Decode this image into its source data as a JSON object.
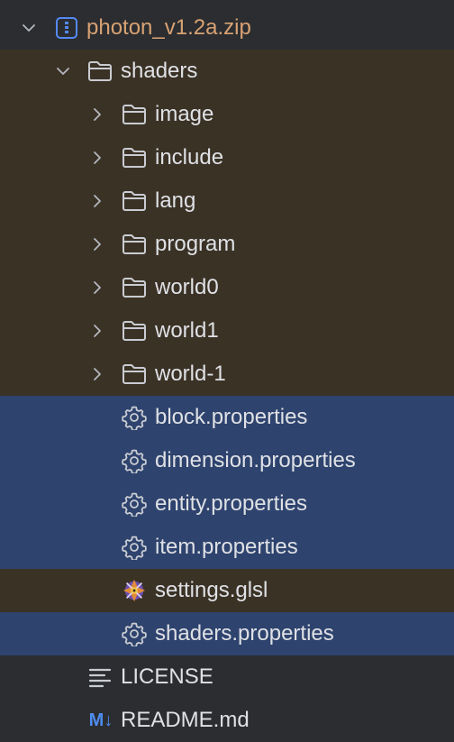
{
  "tree": {
    "root": {
      "label": "photon_v1.2a.zip",
      "icon": "archive-icon",
      "expanded": true
    },
    "shaders_folder": {
      "label": "shaders",
      "icon": "folder-icon",
      "expanded": true
    },
    "subfolders": [
      {
        "label": "image",
        "icon": "folder-icon"
      },
      {
        "label": "include",
        "icon": "folder-icon"
      },
      {
        "label": "lang",
        "icon": "folder-icon"
      },
      {
        "label": "program",
        "icon": "folder-icon"
      },
      {
        "label": "world0",
        "icon": "folder-icon"
      },
      {
        "label": "world1",
        "icon": "folder-icon"
      },
      {
        "label": "world-1",
        "icon": "folder-icon"
      }
    ],
    "files": [
      {
        "label": "block.properties",
        "icon": "gear-icon",
        "selected": true
      },
      {
        "label": "dimension.properties",
        "icon": "gear-icon",
        "selected": true
      },
      {
        "label": "entity.properties",
        "icon": "gear-icon",
        "selected": true
      },
      {
        "label": "item.properties",
        "icon": "gear-icon",
        "selected": true
      },
      {
        "label": "settings.glsl",
        "icon": "glsl-shader-icon",
        "selected": false
      },
      {
        "label": "shaders.properties",
        "icon": "gear-icon",
        "selected": true
      }
    ],
    "root_files": [
      {
        "label": "LICENSE",
        "icon": "text-lines-icon"
      },
      {
        "label": "README.md",
        "icon": "markdown-icon",
        "icon_text": "M↓"
      }
    ]
  },
  "colors": {
    "background": "#2b2d30",
    "folder_highlight": "#3b3226",
    "selection": "#2e436e",
    "text": "#dfe1e5",
    "zip_text": "#d9a273",
    "markdown_icon": "#4f8cf0"
  }
}
